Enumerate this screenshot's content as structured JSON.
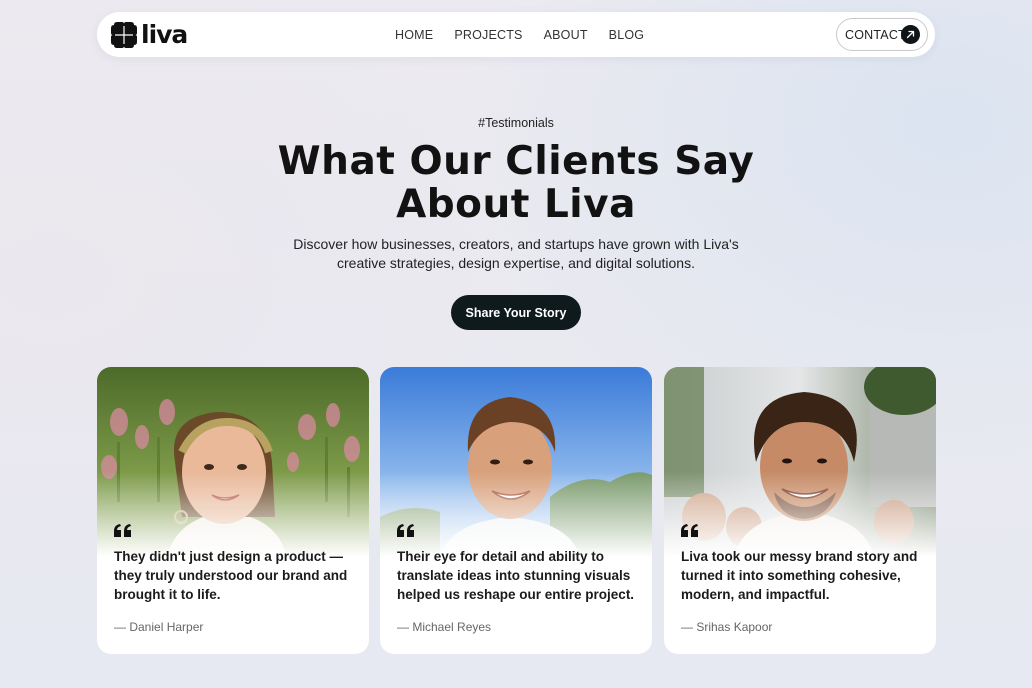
{
  "brand": {
    "name": "liva"
  },
  "nav": {
    "links": [
      "HOME",
      "PROJECTS",
      "ABOUT",
      "BLOG"
    ],
    "contact_label": "CONTACT"
  },
  "hero": {
    "eyebrow": "#Testimonials",
    "title": "What Our Clients Say About Liva",
    "subtitle": "Discover how businesses, creators, and startups have grown with Liva's creative strategies, design expertise, and digital solutions.",
    "cta_label": "Share Your Story"
  },
  "testimonials": [
    {
      "quote": "They didn't just design a product — they truly understood our brand and brought it to life.",
      "dash": "—",
      "author": "Daniel Harper"
    },
    {
      "quote": "Their eye for detail and ability to translate ideas into stunning visuals helped us reshape our entire project.",
      "dash": "—",
      "author": "Michael Reyes"
    },
    {
      "quote": "Liva took our messy brand story and turned it into something cohesive, modern, and impactful.",
      "dash": "—",
      "author": "Srihas Kapoor"
    }
  ],
  "icons": {
    "logo": "four-leaf-icon",
    "contact": "arrow-up-right-icon",
    "quote": "quote-icon"
  },
  "colors": {
    "dark": "#0f1a1c",
    "card": "#ffffff",
    "text": "#111111",
    "muted": "#666666"
  }
}
